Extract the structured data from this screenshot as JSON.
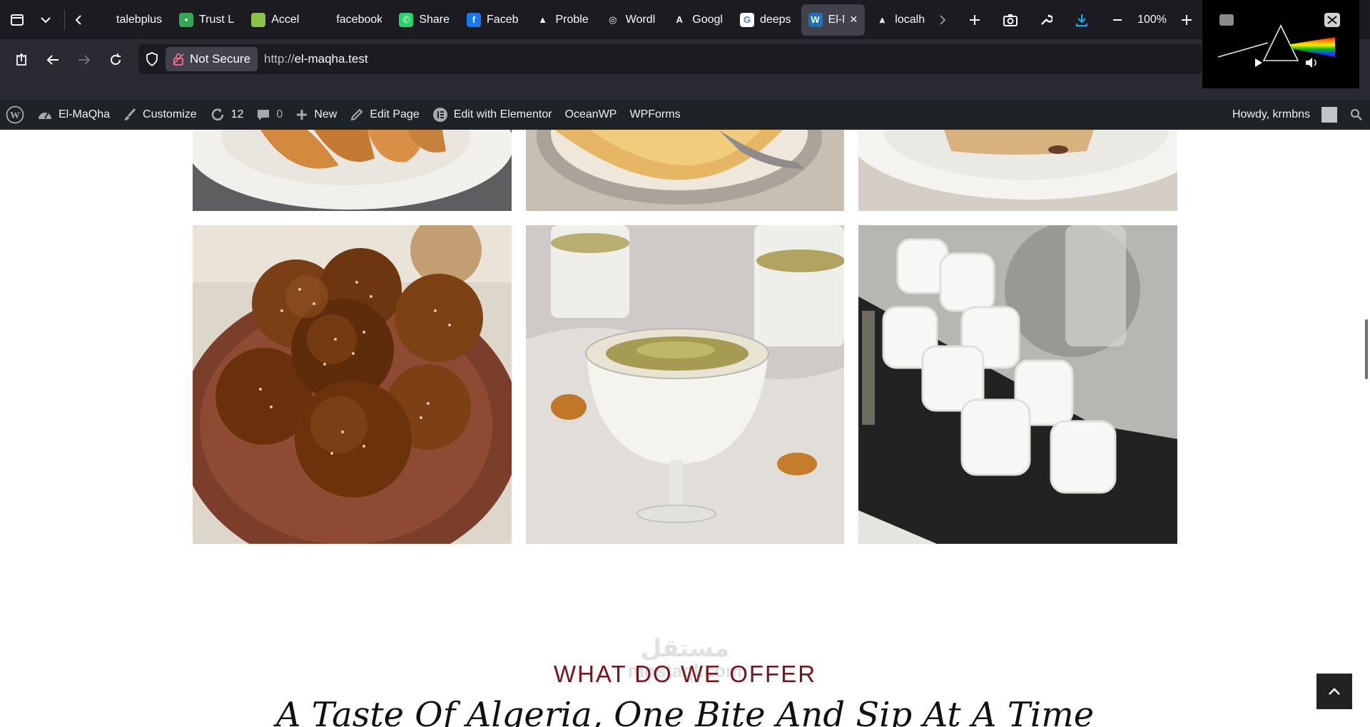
{
  "browser": {
    "tabs": [
      {
        "label": "talebplusn",
        "fav_color": "#1c1b22",
        "fav_char": ""
      },
      {
        "label": "Trust L",
        "fav_color": "#34a853",
        "fav_char": "•"
      },
      {
        "label": "Accel",
        "fav_color": "#8bc34a",
        "fav_char": ""
      },
      {
        "label": "facebook.c",
        "fav_color": "#1c1b22",
        "fav_char": ""
      },
      {
        "label": "Share",
        "fav_color": "#25d366",
        "fav_char": "✆"
      },
      {
        "label": "Faceb",
        "fav_color": "#1877f2",
        "fav_char": "f"
      },
      {
        "label": "Proble",
        "fav_color": "#1c1b22",
        "fav_char": "▲"
      },
      {
        "label": "Wordl",
        "fav_color": "#1c1b22",
        "fav_char": "◎"
      },
      {
        "label": "Googl",
        "fav_color": "#1c1b22",
        "fav_char": "A"
      },
      {
        "label": "deeps",
        "fav_color": "#ffffff",
        "fav_char": "G"
      },
      {
        "label": "El-M",
        "fav_color": "#2271b1",
        "fav_char": "W"
      },
      {
        "label": "localh",
        "fav_color": "#1c1b22",
        "fav_char": "⩓"
      }
    ],
    "zoom": "100%",
    "not_secure": "Not Secure",
    "url_scheme": "http://",
    "url_host": "el-maqha.test"
  },
  "wp_admin_bar": {
    "site_name": "El-MaQha",
    "customize": "Customize",
    "updates_count": "12",
    "comments_count": "0",
    "new": "New",
    "edit_page": "Edit Page",
    "edit_elementor": "Edit with Elementor",
    "oceanwp": "OceanWP",
    "wpforms": "WPForms",
    "howdy": "Howdy, krmbns"
  },
  "section": {
    "subtitle": "WHAT DO WE OFFER",
    "headline": "A Taste Of Algeria, One Bite And Sip At A Time"
  },
  "gallery": [
    {
      "name": "samosa-pastries-photo"
    },
    {
      "name": "crepes-plate-photo"
    },
    {
      "name": "pastry-dessert-photo"
    },
    {
      "name": "sesame-brioche-buns-photo"
    },
    {
      "name": "pistachio-cream-dessert-photo"
    },
    {
      "name": "powdered-sugar-cookies-tea-photo"
    }
  ],
  "watermark": {
    "line1": "مستقل",
    "line2": "mostaql.com"
  }
}
